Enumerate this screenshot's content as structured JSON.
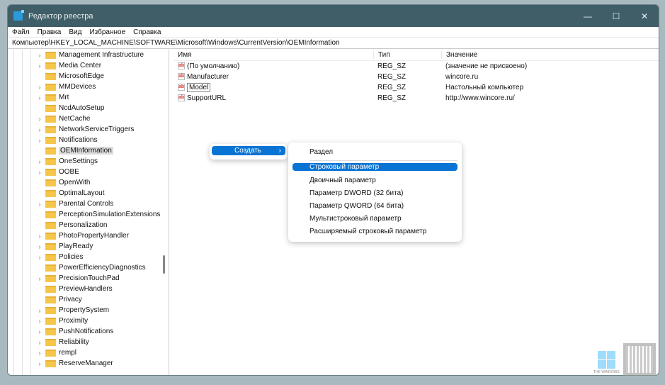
{
  "window": {
    "title": "Редактор реестра",
    "min": "—",
    "max": "☐",
    "close": "✕"
  },
  "menu": [
    "Файл",
    "Правка",
    "Вид",
    "Избранное",
    "Справка"
  ],
  "address": "Компьютер\\HKEY_LOCAL_MACHINE\\SOFTWARE\\Microsoft\\Windows\\CurrentVersion\\OEMInformation",
  "tree": [
    {
      "label": "Management Infrastructure",
      "exp": true
    },
    {
      "label": "Media Center",
      "exp": true
    },
    {
      "label": "MicrosoftEdge",
      "exp": false
    },
    {
      "label": "MMDevices",
      "exp": true
    },
    {
      "label": "Mrt",
      "exp": true
    },
    {
      "label": "NcdAutoSetup",
      "exp": false
    },
    {
      "label": "NetCache",
      "exp": true
    },
    {
      "label": "NetworkServiceTriggers",
      "exp": true
    },
    {
      "label": "Notifications",
      "exp": true
    },
    {
      "label": "OEMInformation",
      "exp": false,
      "selected": true
    },
    {
      "label": "OneSettings",
      "exp": true
    },
    {
      "label": "OOBE",
      "exp": true
    },
    {
      "label": "OpenWith",
      "exp": false
    },
    {
      "label": "OptimalLayout",
      "exp": false
    },
    {
      "label": "Parental Controls",
      "exp": true
    },
    {
      "label": "PerceptionSimulationExtensions",
      "exp": false
    },
    {
      "label": "Personalization",
      "exp": false
    },
    {
      "label": "PhotoPropertyHandler",
      "exp": true
    },
    {
      "label": "PlayReady",
      "exp": true
    },
    {
      "label": "Policies",
      "exp": true
    },
    {
      "label": "PowerEfficiencyDiagnostics",
      "exp": false
    },
    {
      "label": "PrecisionTouchPad",
      "exp": true
    },
    {
      "label": "PreviewHandlers",
      "exp": false
    },
    {
      "label": "Privacy",
      "exp": false
    },
    {
      "label": "PropertySystem",
      "exp": true
    },
    {
      "label": "Proximity",
      "exp": true
    },
    {
      "label": "PushNotifications",
      "exp": true
    },
    {
      "label": "Reliability",
      "exp": true
    },
    {
      "label": "rempl",
      "exp": true
    },
    {
      "label": "ReserveManager",
      "exp": true
    }
  ],
  "columns": {
    "name": "Имя",
    "type": "Тип",
    "value": "Значение"
  },
  "values": [
    {
      "name": "(По умолчанию)",
      "type": "REG_SZ",
      "value": "(значение не присвоено)"
    },
    {
      "name": "Manufacturer",
      "type": "REG_SZ",
      "value": "wincore.ru"
    },
    {
      "name": "Model",
      "type": "REG_SZ",
      "value": "Настольный компьютер",
      "focused": true
    },
    {
      "name": "SupportURL",
      "type": "REG_SZ",
      "value": "http://www.wincore.ru/"
    }
  ],
  "context": {
    "create": "Создать",
    "arrow": "›",
    "submenu": [
      "Раздел",
      "Строковый параметр",
      "Двоичный параметр",
      "Параметр DWORD (32 бита)",
      "Параметр QWORD (64 бита)",
      "Мультистроковый параметр",
      "Расширяемый строковый параметр"
    ]
  },
  "icon_text": "ab",
  "watermark": "THE WINDOWS"
}
